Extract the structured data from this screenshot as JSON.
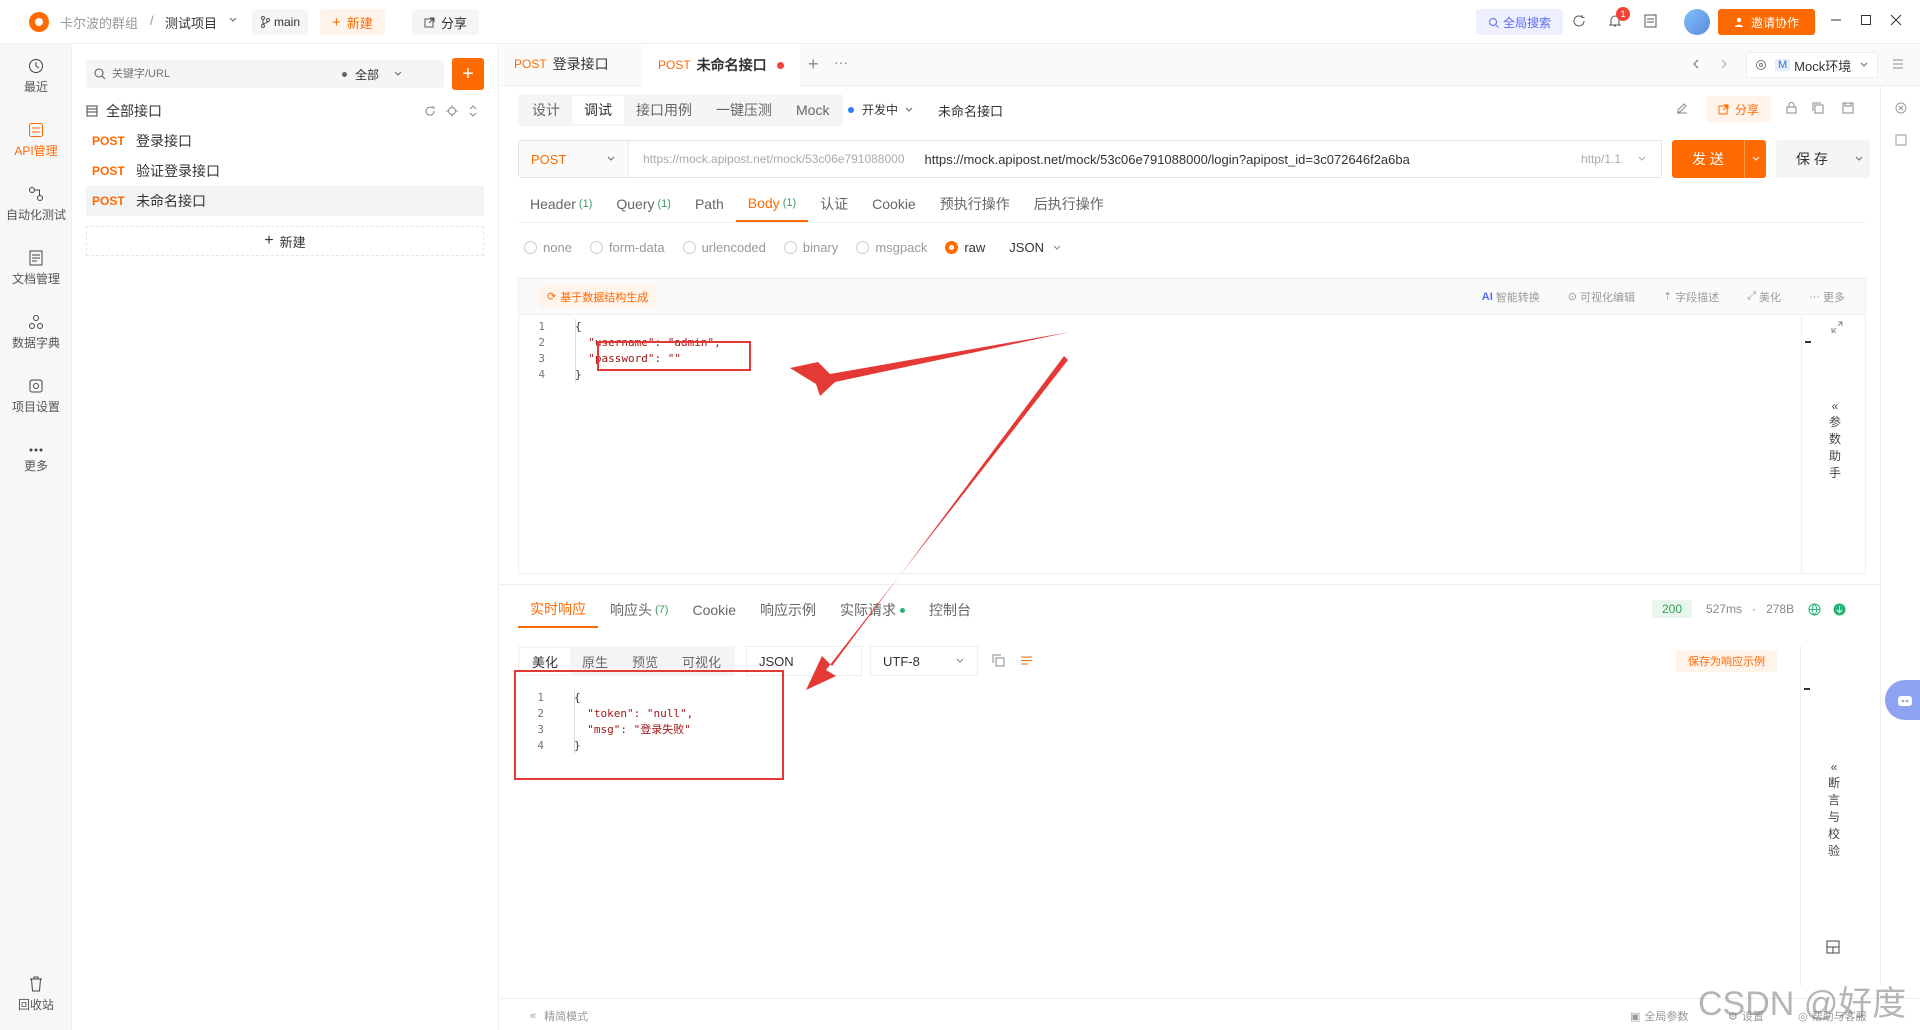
{
  "titlebar": {
    "group": "卡尔波的群组",
    "separator": "/",
    "project": "测试项目",
    "branch": "main",
    "new_label": "新建",
    "share_label": "分享",
    "global_search": "全局搜索",
    "notification_count": "1",
    "invite_label": "邀请协作"
  },
  "leftnav": {
    "items": [
      {
        "label": "最近",
        "icon": "clock-icon"
      },
      {
        "label": "API管理",
        "icon": "api-icon"
      },
      {
        "label": "自动化测试",
        "icon": "automation-icon"
      },
      {
        "label": "文档管理",
        "icon": "document-icon"
      },
      {
        "label": "数据字典",
        "icon": "dictionary-icon"
      },
      {
        "label": "项目设置",
        "icon": "settings-icon"
      },
      {
        "label": "更多",
        "icon": "more-icon"
      }
    ],
    "trash": "回收站"
  },
  "tree": {
    "search_placeholder": "关键字/URL",
    "filter": "全部",
    "root": "全部接口",
    "items": [
      {
        "method": "POST",
        "name": "登录接口"
      },
      {
        "method": "POST",
        "name": "验证登录接口"
      },
      {
        "method": "POST",
        "name": "未命名接口"
      }
    ],
    "new_label": "新建"
  },
  "tabs": {
    "items": [
      {
        "method": "POST",
        "name": "登录接口"
      },
      {
        "method": "POST",
        "name": "未命名接口"
      }
    ],
    "env_badge": "M",
    "env": "Mock环境"
  },
  "modebar": {
    "modes": [
      "设计",
      "调试",
      "接口用例",
      "一键压测",
      "Mock"
    ],
    "status": "开发中",
    "api_name": "未命名接口",
    "share": "分享"
  },
  "request": {
    "method": "POST",
    "base_url": "https://mock.apipost.net/mock/53c06e791088000",
    "full_url": "https://mock.apipost.net/mock/53c06e791088000/login?apipost_id=3c072646f2a6ba",
    "protocol": "http/1.1",
    "send": "发 送",
    "save": "保 存"
  },
  "req_tabs": [
    {
      "label": "Header",
      "count": "(1)"
    },
    {
      "label": "Query",
      "count": "(1)"
    },
    {
      "label": "Path",
      "count": ""
    },
    {
      "label": "Body",
      "count": "(1)"
    },
    {
      "label": "认证",
      "count": ""
    },
    {
      "label": "Cookie",
      "count": ""
    },
    {
      "label": "预执行操作",
      "count": ""
    },
    {
      "label": "后执行操作",
      "count": ""
    }
  ],
  "body_types": [
    "none",
    "form-data",
    "urlencoded",
    "binary",
    "msgpack",
    "raw"
  ],
  "body_format": "JSON",
  "body_toolbar": {
    "generate": "基于数据结构生成",
    "ai": "智能转换",
    "visual": "可视化编辑",
    "field_desc": "字段描述",
    "beautify": "美化",
    "more": "更多"
  },
  "request_code": [
    {
      "n": "1",
      "text": "{"
    },
    {
      "n": "2",
      "text": "  \"username\": \"admin\","
    },
    {
      "n": "3",
      "text": "  \"password\": \"\""
    },
    {
      "n": "4",
      "text": "}"
    }
  ],
  "param_helper": [
    "参",
    "数",
    "助",
    "手"
  ],
  "resp_tabs": [
    {
      "label": "实时响应",
      "count": ""
    },
    {
      "label": "响应头",
      "count": "(7)"
    },
    {
      "label": "Cookie",
      "count": ""
    },
    {
      "label": "响应示例",
      "count": ""
    },
    {
      "label": "实际请求",
      "count": ""
    },
    {
      "label": "控制台",
      "count": ""
    }
  ],
  "resp_meta": {
    "status": "200",
    "time": "527ms",
    "size": "278B"
  },
  "resp_view": [
    "美化",
    "原生",
    "预览",
    "可视化"
  ],
  "resp_format": "JSON",
  "resp_encoding": "UTF-8",
  "save_example": "保存为响应示例",
  "response_code": [
    {
      "n": "1",
      "text": "{"
    },
    {
      "n": "2",
      "text": "  \"token\": \"null\","
    },
    {
      "n": "3",
      "text": "  \"msg\": \"登录失败\""
    },
    {
      "n": "4",
      "text": "}"
    }
  ],
  "assert_helper": [
    "断",
    "言",
    "与",
    "校",
    "验"
  ],
  "footer": {
    "simple_mode": "精简模式",
    "global_params": "全局参数",
    "settings": "设置",
    "help": "帮助与客服"
  },
  "watermark": "CSDN @好度",
  "colors": {
    "accent": "#ff6a00",
    "annotation": "#e53935"
  }
}
